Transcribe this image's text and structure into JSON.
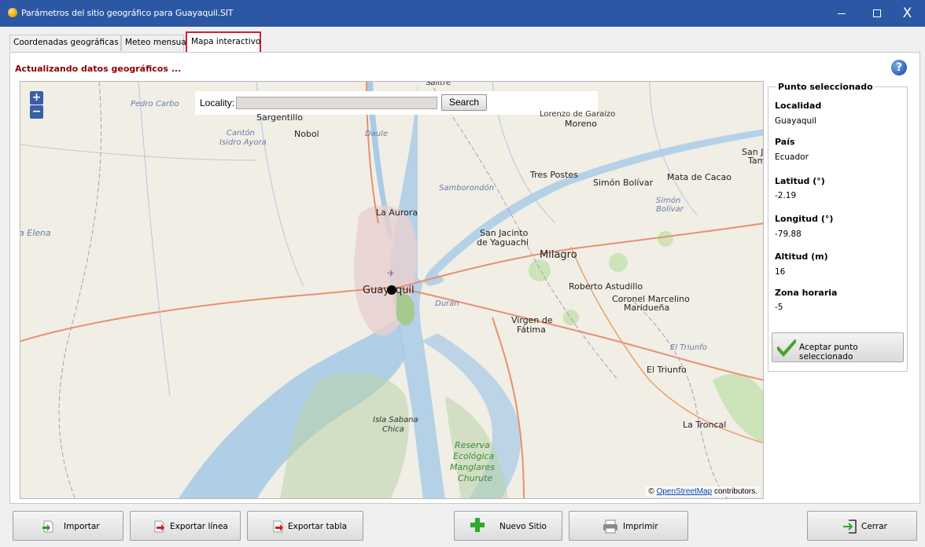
{
  "window": {
    "title": "Parámetros del sitio geográfico para Guayaquil.SIT",
    "minimize_icon": "minimize-icon",
    "maximize_icon": "maximize-icon",
    "close_glyph": "X"
  },
  "tabs": [
    {
      "label": "Coordenadas geográficas"
    },
    {
      "label": "Meteo mensual"
    },
    {
      "label": "Mapa interactivo",
      "active": true
    }
  ],
  "status_text": "Actualizando datos geográficos ...",
  "help_glyph": "?",
  "map": {
    "zoom_in": "+",
    "zoom_out": "−",
    "search": {
      "label": "Locality:",
      "value": "",
      "button": "Search"
    },
    "attribution": {
      "prefix": "©",
      "link": "OpenStreetMap",
      "suffix": "contributors."
    },
    "labels": {
      "salitre": "Salitre",
      "pedro_carbo": "Pedro Carbo",
      "sargentillo": "Sargentillo",
      "lorenzo": "Lorenzo de Garaizo",
      "moreno": "Moreno",
      "canton": "Cantón",
      "isidro": "Isidro Ayora",
      "nobol": "Nobol",
      "daule": "Daule",
      "san_jo": "San Jo",
      "tam": "Tam",
      "tres_postes": "Tres Postes",
      "simon1": "Simón Bolívar",
      "mata": "Mata de Cacao",
      "simon_i1": "Simón",
      "simon_i2": "Bolívar",
      "samborondon": "Samborondón",
      "la_aurora": "La Aurora",
      "elena": "a Elena",
      "sanjacinto1": "San Jacinto",
      "sanjacinto2": "de Yaguachi",
      "milagro": "Milagro",
      "guayaquil": "Guayaquil",
      "duran": "Durán",
      "roberto": "Roberto Astudillo",
      "coronel1": "Coronel Marcelino",
      "coronel2": "Maridueña",
      "virgen1": "Virgen de",
      "virgen2": "Fátima",
      "triunfo_i": "El Triunfo",
      "triunfo": "El Triunfo",
      "troncal": "La Troncal",
      "isla1": "Isla Sabana",
      "isla2": "Chica",
      "reserva1": "Reserva",
      "reserva2": "Ecológica",
      "reserva3": "Manglares",
      "reserva4": "Churute"
    }
  },
  "selected_point": {
    "legend": "Punto seleccionado",
    "localidad_label": "Localidad",
    "localidad_value": "Guayaquil",
    "pais_label": "País",
    "pais_value": "Ecuador",
    "latitud_label": "Latitud (°)",
    "latitud_value": "-2.19",
    "longitud_label": "Longitud (°)",
    "longitud_value": "-79.88",
    "altitud_label": "Altitud (m)",
    "altitud_value": "16",
    "zona_label": "Zona horaria",
    "zona_value": "-5",
    "accept_button": "Aceptar punto seleccionado"
  },
  "bottom_buttons": {
    "importar": "Importar",
    "exportar_linea": "Exportar línea",
    "exportar_tabla": "Exportar tabla",
    "nuevo_sitio": "Nuevo Sitio",
    "imprimir": "Imprimir",
    "cerrar": "Cerrar"
  },
  "colors": {
    "titlebar": "#2b57a4",
    "status_text": "#8b0000",
    "active_tab_highlight": "#d42030",
    "water": "#a9cbe6",
    "land": "#f1eee6"
  }
}
